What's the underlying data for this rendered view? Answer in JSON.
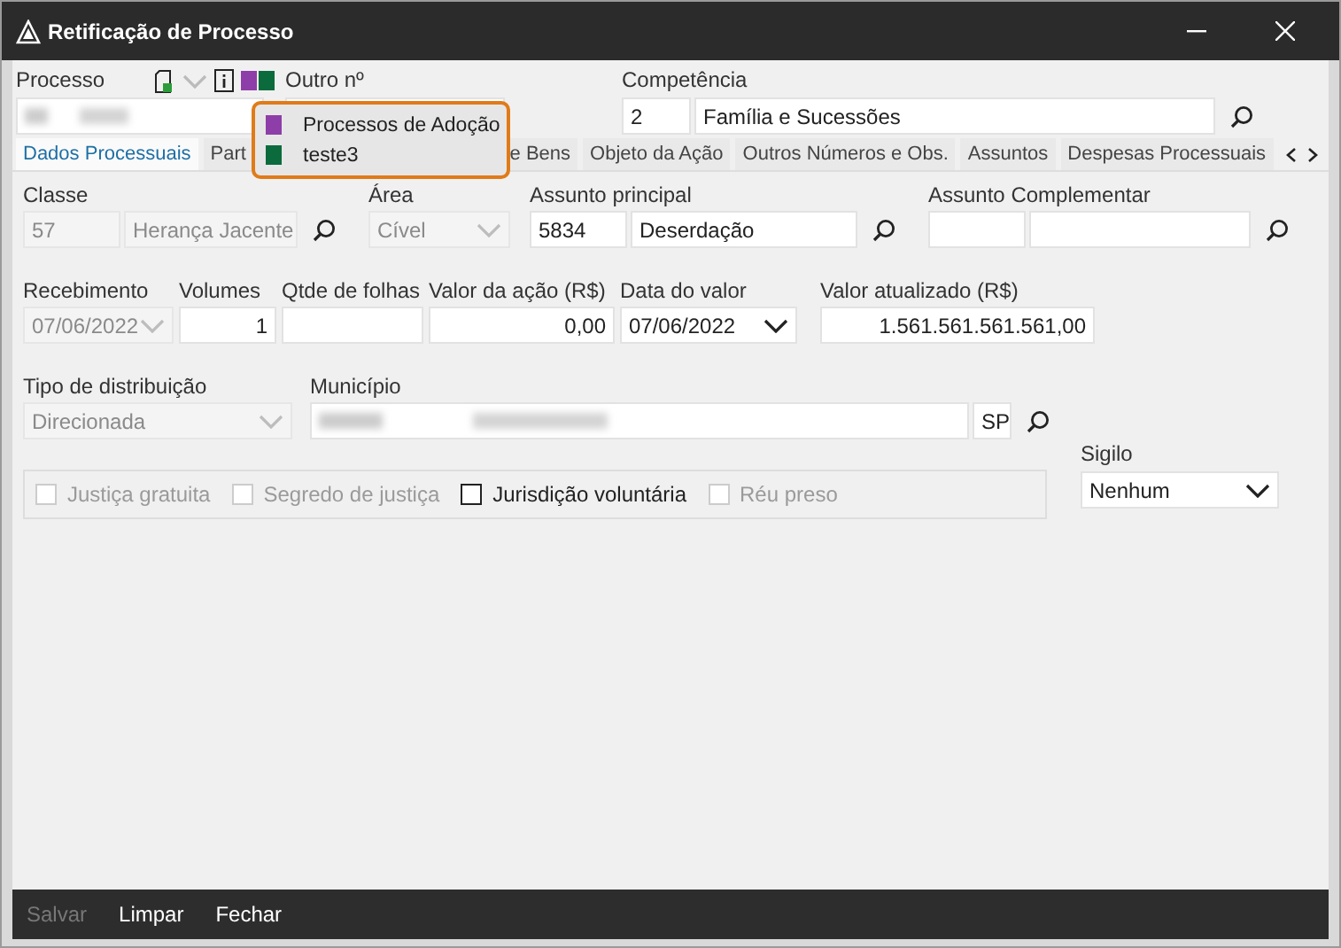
{
  "window": {
    "title": "Retificação de Processo"
  },
  "header": {
    "processo_label": "Processo",
    "tags": [
      {
        "color": "#8e3ea8"
      },
      {
        "color": "#0b6b3c"
      }
    ],
    "outro_label": "Outro nº",
    "competencia_label": "Competência",
    "competencia_code": "2",
    "competencia_name": "Família e Sucessões"
  },
  "popup": {
    "items": [
      {
        "label": "Processos de Adoção",
        "color": "#8e3ea8"
      },
      {
        "label": "teste3",
        "color": "#0b6b3c"
      }
    ]
  },
  "tabs": [
    {
      "label": "Dados Processuais",
      "selected": true
    },
    {
      "label": "Part",
      "selected": false
    },
    {
      "label": "e Bens",
      "selected": false
    },
    {
      "label": "Objeto da Ação",
      "selected": false
    },
    {
      "label": "Outros Números e Obs.",
      "selected": false
    },
    {
      "label": "Assuntos",
      "selected": false
    },
    {
      "label": "Despesas Processuais",
      "selected": false
    }
  ],
  "rows": [
    [
      {
        "label": "Classe",
        "fields": [
          {
            "kind": "text",
            "value": "57",
            "disabled": true
          },
          {
            "kind": "text",
            "value": "Herança Jacente",
            "disabled": true
          },
          {
            "kind": "search"
          }
        ]
      },
      {
        "label": "Área",
        "fields": [
          {
            "kind": "select",
            "value": "Cível",
            "disabled": true
          }
        ]
      },
      {
        "label": "Assunto principal",
        "fields": [
          {
            "kind": "text",
            "value": "5834",
            "disabled": false
          },
          {
            "kind": "text",
            "value": "Deserdação",
            "disabled": false
          },
          {
            "kind": "search"
          }
        ]
      },
      {
        "label": "Assunto Complementar",
        "fields": [
          {
            "kind": "text"
          },
          {
            "kind": "text"
          },
          {
            "kind": "search"
          }
        ]
      }
    ],
    [
      {
        "label": "Recebimento",
        "fields": [
          {
            "kind": "select",
            "value": "07/06/2022",
            "disabled": true
          }
        ]
      },
      {
        "label": "Volumes",
        "fields": [
          {
            "kind": "number",
            "value": "1",
            "disabled": false
          }
        ]
      },
      {
        "label": "Qtde de folhas",
        "fields": [
          {
            "kind": "number"
          }
        ]
      },
      {
        "label": "Valor da ação (R$)",
        "fields": [
          {
            "kind": "number",
            "value": "0,00",
            "disabled": false
          }
        ]
      },
      {
        "label": "Data do valor",
        "fields": [
          {
            "kind": "select",
            "value": "07/06/2022",
            "disabled": false
          }
        ]
      },
      {
        "label": "Valor atualizado (R$)",
        "fields": [
          {
            "kind": "number",
            "value": "1.561.561.561.561,00",
            "disabled": false
          }
        ]
      }
    ],
    [
      {
        "label": "Tipo de distribuição",
        "fields": [
          {
            "kind": "select",
            "value": "Direcionada",
            "disabled": true
          }
        ]
      },
      {
        "label": "Município",
        "fields": [
          {
            "kind": "blurred"
          },
          {
            "kind": "text",
            "value": "SP",
            "disabled": false
          },
          {
            "kind": "search"
          }
        ]
      }
    ]
  ],
  "checkboxes": [
    {
      "label": "Justiça gratuita",
      "checked": false,
      "disabled": true
    },
    {
      "label": "Segredo de justiça",
      "checked": false,
      "disabled": true
    },
    {
      "label": "Jurisdição voluntária",
      "checked": false,
      "disabled": false
    },
    {
      "label": "Réu preso",
      "checked": false,
      "disabled": true
    }
  ],
  "sigilo": {
    "label": "Sigilo",
    "value": "Nenhum"
  },
  "buttons": [
    {
      "label": "Salvar",
      "disabled": true
    },
    {
      "label": "Limpar",
      "disabled": false
    },
    {
      "label": "Fechar",
      "disabled": false
    }
  ]
}
